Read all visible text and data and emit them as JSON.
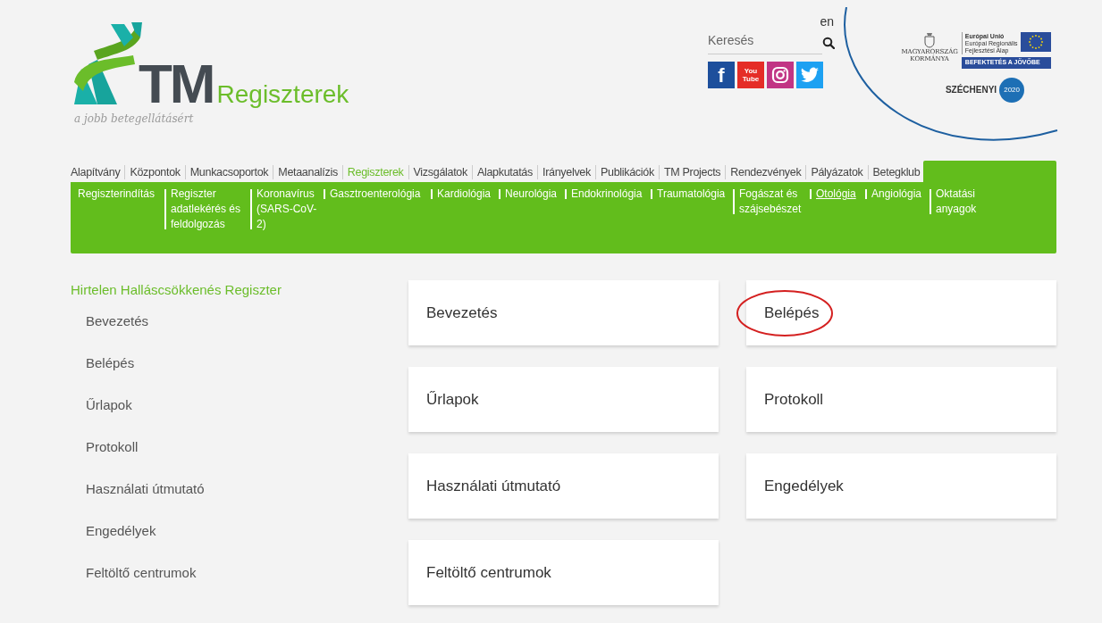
{
  "logo": {
    "brand": "TM",
    "name": "Regiszterek",
    "tagline": "a jobb betegellátásért"
  },
  "language": "en",
  "search": {
    "placeholder": "Keresés"
  },
  "social": [
    {
      "kind": "facebook",
      "label": "f"
    },
    {
      "kind": "youtube",
      "label": "You\nTube"
    },
    {
      "kind": "instagram"
    },
    {
      "kind": "twitter"
    }
  ],
  "sponsors": {
    "government": "MAGYARORSZÁG\nKORMÁNYA",
    "eu_title": "Európai Unió",
    "eu_fund": "Európai Regionális\nFejlesztési Alap",
    "slogan": "BEFEKTETÉS A JÖVŐBE",
    "program": "SZÉCHENYI",
    "year": "2020"
  },
  "main_nav": [
    {
      "label": "Alapítvány",
      "selected": false
    },
    {
      "label": "Központok",
      "selected": false
    },
    {
      "label": "Munkacsoportok",
      "selected": false
    },
    {
      "label": "Metaanalízis",
      "selected": false
    },
    {
      "label": "Regiszterek",
      "selected": true
    },
    {
      "label": "Vizsgálatok",
      "selected": false
    },
    {
      "label": "Alapkutatás",
      "selected": false
    },
    {
      "label": "Irányelvek",
      "selected": false
    },
    {
      "label": "Publikációk",
      "selected": false
    },
    {
      "label": "TM Projects",
      "selected": false
    },
    {
      "label": "Rendezvények",
      "selected": false
    },
    {
      "label": "Pályázatok",
      "selected": false
    },
    {
      "label": "Betegklub",
      "selected": false
    }
  ],
  "sub_nav": [
    {
      "label": "Regiszterindítás",
      "selected": false
    },
    {
      "label": "Regiszter adatlekérés és feldolgozás",
      "selected": false
    },
    {
      "label": "Koronavírus (SARS-CoV-2)",
      "selected": false
    },
    {
      "label": "Gasztroenterológia",
      "selected": false
    },
    {
      "label": "Kardiológia",
      "selected": false
    },
    {
      "label": "Neurológia",
      "selected": false
    },
    {
      "label": "Endokrinológia",
      "selected": false
    },
    {
      "label": "Traumatológia",
      "selected": false
    },
    {
      "label": "Fogászat és szájsebészet",
      "selected": false
    },
    {
      "label": "Otológia",
      "selected": true
    },
    {
      "label": "Angiológia",
      "selected": false
    },
    {
      "label": "Oktatási anyagok",
      "selected": false
    }
  ],
  "sidebar": {
    "title": "Hirtelen Halláscsökkenés Regiszter",
    "items": [
      "Bevezetés",
      "Belépés",
      "Űrlapok",
      "Protokoll",
      "Használati útmutató",
      "Engedélyek",
      "Feltöltő centrumok"
    ]
  },
  "cards": [
    {
      "label": "Bevezetés",
      "circled": false
    },
    {
      "label": "Belépés",
      "circled": true
    },
    {
      "label": "Űrlapok",
      "circled": false
    },
    {
      "label": "Protokoll",
      "circled": false
    },
    {
      "label": "Használati útmutató",
      "circled": false
    },
    {
      "label": "Engedélyek",
      "circled": false
    },
    {
      "label": "Feltöltő centrumok",
      "circled": false
    }
  ]
}
